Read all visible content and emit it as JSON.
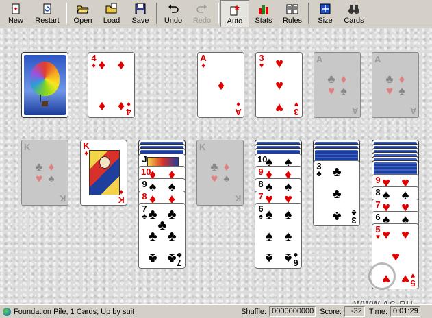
{
  "toolbar": {
    "new": "New",
    "restart": "Restart",
    "open": "Open",
    "load": "Load",
    "save": "Save",
    "undo": "Undo",
    "redo": "Redo",
    "auto": "Auto",
    "stats": "Stats",
    "rules": "Rules",
    "size": "Size",
    "cards": "Cards"
  },
  "cards": {
    "waste_top": {
      "rank": "4",
      "suit": "♦"
    },
    "foundation1": {
      "rank": "A",
      "suit": "♦"
    },
    "foundation2": {
      "rank": "3",
      "suit": "♥"
    },
    "empty_letter_a": "A",
    "empty_letter_k": "K",
    "tab2_top": {
      "rank": "K",
      "suit": "♦"
    },
    "tab3": [
      {
        "rank": "J",
        "suit": "♣"
      },
      {
        "rank": "10",
        "suit": "♦"
      },
      {
        "rank": "9",
        "suit": "♠"
      },
      {
        "rank": "8",
        "suit": "♦"
      },
      {
        "rank": "7",
        "suit": "♣"
      }
    ],
    "tab5": [
      {
        "rank": "10",
        "suit": "♠"
      },
      {
        "rank": "9",
        "suit": "♦"
      },
      {
        "rank": "8",
        "suit": "♠"
      },
      {
        "rank": "7",
        "suit": "♥"
      },
      {
        "rank": "6",
        "suit": "♠"
      }
    ],
    "tab6_top": {
      "rank": "3",
      "suit": "♣"
    },
    "tab7": [
      {
        "rank": "9",
        "suit": "♥"
      },
      {
        "rank": "8",
        "suit": "♠"
      },
      {
        "rank": "7",
        "suit": "♥"
      },
      {
        "rank": "6",
        "suit": "♠"
      },
      {
        "rank": "5",
        "suit": "♥"
      }
    ]
  },
  "status": {
    "message": "Foundation Pile, 1 Cards, Up by suit",
    "shuffle_label": "Shuffle:",
    "shuffle_value": "0000000000",
    "score_label": "Score:",
    "score_value": "-32",
    "time_label": "Time:",
    "time_value": "0:01:29"
  },
  "watermark": "WWW.AG.RU"
}
